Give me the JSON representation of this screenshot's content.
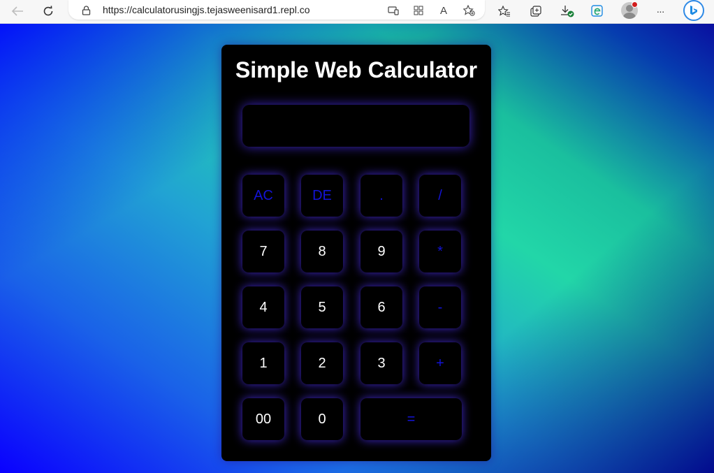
{
  "browser": {
    "url": "https://calculatorusingjs.tejasweenisard1.repl.co",
    "icons": {
      "back": "back-arrow-icon",
      "reload": "reload-icon",
      "lock": "lock-icon",
      "app_available": "app-available-icon",
      "apps": "apps-icon",
      "read_aloud": "read-aloud-icon",
      "add_favorite": "add-favorite-icon",
      "favorites": "favorites-icon",
      "collections": "collections-icon",
      "downloads": "downloads-icon",
      "edge_ext": "edge-extension-icon",
      "more": "more-icon",
      "bing": "bing-chat-icon"
    },
    "read_aloud_label": "A",
    "more_label": "···"
  },
  "calculator": {
    "title": "Simple Web Calculator",
    "display_value": "",
    "op_color": "#1313d6",
    "digit_color": "#ffffff",
    "glow_color": "#5032ff",
    "rows": [
      [
        {
          "label": "AC",
          "type": "op",
          "name": "clear-button"
        },
        {
          "label": "DE",
          "type": "op",
          "name": "delete-button"
        },
        {
          "label": ".",
          "type": "op",
          "name": "decimal-button"
        },
        {
          "label": "/",
          "type": "op",
          "name": "divide-button"
        }
      ],
      [
        {
          "label": "7",
          "type": "digit",
          "name": "digit-7-button"
        },
        {
          "label": "8",
          "type": "digit",
          "name": "digit-8-button"
        },
        {
          "label": "9",
          "type": "digit",
          "name": "digit-9-button"
        },
        {
          "label": "*",
          "type": "op",
          "name": "multiply-button"
        }
      ],
      [
        {
          "label": "4",
          "type": "digit",
          "name": "digit-4-button"
        },
        {
          "label": "5",
          "type": "digit",
          "name": "digit-5-button"
        },
        {
          "label": "6",
          "type": "digit",
          "name": "digit-6-button"
        },
        {
          "label": "-",
          "type": "op",
          "name": "subtract-button"
        }
      ],
      [
        {
          "label": "1",
          "type": "digit",
          "name": "digit-1-button"
        },
        {
          "label": "2",
          "type": "digit",
          "name": "digit-2-button"
        },
        {
          "label": "3",
          "type": "digit",
          "name": "digit-3-button"
        },
        {
          "label": "+",
          "type": "op",
          "name": "add-button"
        }
      ],
      [
        {
          "label": "00",
          "type": "digit",
          "name": "double-zero-button"
        },
        {
          "label": "0",
          "type": "digit",
          "name": "digit-0-button"
        },
        {
          "label": "=",
          "type": "op",
          "name": "equals-button",
          "wide": true
        }
      ]
    ]
  }
}
